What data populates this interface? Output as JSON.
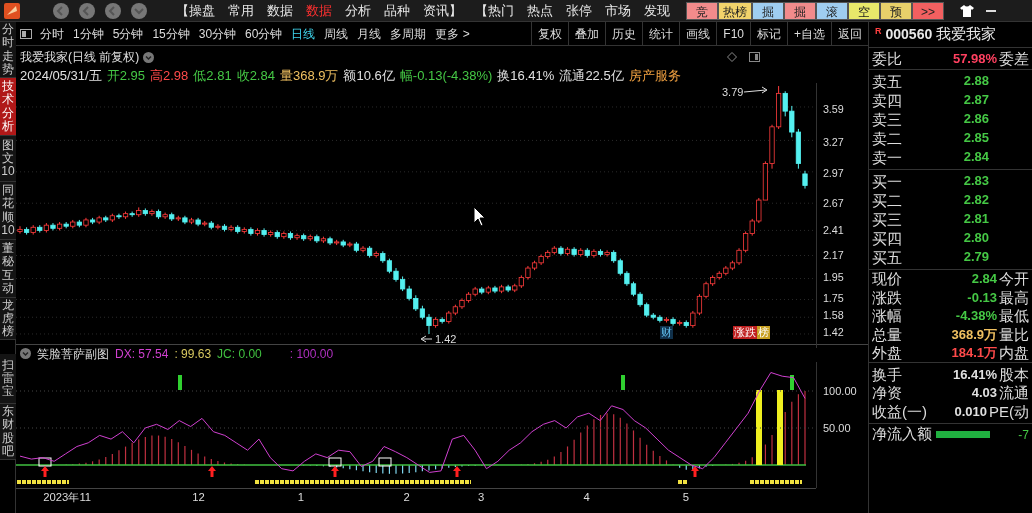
{
  "top_bar": {
    "menu": [
      {
        "label": "【操盘",
        "selected": false
      },
      {
        "label": "常用",
        "selected": false
      },
      {
        "label": "数据",
        "selected": false
      },
      {
        "label": "数据",
        "selected": true
      },
      {
        "label": "分析",
        "selected": false
      },
      {
        "label": "品种",
        "selected": false
      },
      {
        "label": "资讯】",
        "selected": false
      },
      {
        "label": "【热门",
        "selected": false
      },
      {
        "label": "热点",
        "selected": false
      },
      {
        "label": "张停",
        "selected": false
      },
      {
        "label": "市场",
        "selected": false
      },
      {
        "label": "发现",
        "selected": false
      }
    ],
    "quick_buttons": [
      {
        "label": "竞",
        "color": "#f28b8b"
      },
      {
        "label": "热榜",
        "color": "#f2d36b"
      },
      {
        "label": "掘",
        "color": "#9fcdf0"
      },
      {
        "label": "掘",
        "color": "#f28b8b"
      },
      {
        "label": "滚",
        "color": "#9fcdf0"
      },
      {
        "label": "空",
        "color": "#e8e86a"
      },
      {
        "label": "预",
        "color": "#e8d06a"
      },
      {
        "label": ">>",
        "color": "#f26060"
      }
    ]
  },
  "sidebar": {
    "tabs": [
      {
        "label": "分时走势",
        "selected": false
      },
      {
        "label": "技术分析",
        "selected": true
      },
      {
        "label": "图文10",
        "selected": false
      },
      {
        "label": "同花顺10",
        "selected": false
      },
      {
        "label": "董秘互动",
        "selected": false
      },
      {
        "label": "龙虎榜",
        "selected": false
      },
      {
        "label": "扫雷宝",
        "selected": false
      },
      {
        "label": "东财股吧",
        "selected": false
      }
    ]
  },
  "periods": [
    {
      "label": "分时",
      "selected": false
    },
    {
      "label": "1分钟",
      "selected": false
    },
    {
      "label": "5分钟",
      "selected": false
    },
    {
      "label": "15分钟",
      "selected": false
    },
    {
      "label": "30分钟",
      "selected": false
    },
    {
      "label": "60分钟",
      "selected": false
    },
    {
      "label": "日线",
      "selected": true
    },
    {
      "label": "周线",
      "selected": false
    },
    {
      "label": "月线",
      "selected": false
    },
    {
      "label": "多周期",
      "selected": false
    },
    {
      "label": "更多 >",
      "selected": false
    }
  ],
  "tools": [
    "复权",
    "叠加",
    "历史",
    "统计",
    "画线",
    "F10",
    "标记",
    "+自选",
    "返回"
  ],
  "chart": {
    "title": "我爱我家(日线 前复权)",
    "info": [
      {
        "text": "2024/05/31/五",
        "color": "#e0e0e0"
      },
      {
        "text": "开2.95",
        "color": "#45c845"
      },
      {
        "text": "高2.98",
        "color": "#ff4a4a"
      },
      {
        "text": "低2.81",
        "color": "#45c845"
      },
      {
        "text": "收2.84",
        "color": "#45c845"
      },
      {
        "text": "量368.9万",
        "color": "#f0c060"
      },
      {
        "text": "额10.6亿",
        "color": "#e0e0e0"
      },
      {
        "text": "幅-0.13(-4.38%)",
        "color": "#45c845"
      },
      {
        "text": "换16.41%",
        "color": "#e0e0e0"
      },
      {
        "text": "流通22.5亿",
        "color": "#e0e0e0"
      },
      {
        "text": "房产服务",
        "color": "#f0a040"
      }
    ],
    "high_label": "3.79",
    "low_label": "1.42",
    "markers": [
      {
        "label": "财",
        "kind": "plain"
      },
      {
        "label": "涨跌",
        "kind": "red"
      },
      {
        "label": "榜",
        "kind": "yellow"
      }
    ],
    "chart_data": {
      "type": "candlestick",
      "grid": true,
      "ylim": [
        1.286,
        3.819
      ],
      "yticks": [
        3.59,
        3.27,
        2.97,
        2.67,
        2.41,
        2.17,
        1.95,
        1.75,
        1.58,
        1.42
      ],
      "ohlc": [
        [
          2.4,
          2.45,
          2.38,
          2.42
        ],
        [
          2.42,
          2.44,
          2.37,
          2.39
        ],
        [
          2.39,
          2.46,
          2.37,
          2.44
        ],
        [
          2.44,
          2.46,
          2.39,
          2.41
        ],
        [
          2.41,
          2.48,
          2.39,
          2.46
        ],
        [
          2.46,
          2.48,
          2.41,
          2.43
        ],
        [
          2.43,
          2.49,
          2.41,
          2.47
        ],
        [
          2.47,
          2.49,
          2.43,
          2.45
        ],
        [
          2.45,
          2.51,
          2.43,
          2.49
        ],
        [
          2.49,
          2.51,
          2.44,
          2.46
        ],
        [
          2.46,
          2.53,
          2.44,
          2.51
        ],
        [
          2.51,
          2.53,
          2.47,
          2.49
        ],
        [
          2.49,
          2.55,
          2.47,
          2.53
        ],
        [
          2.53,
          2.55,
          2.49,
          2.51
        ],
        [
          2.51,
          2.57,
          2.49,
          2.55
        ],
        [
          2.55,
          2.57,
          2.52,
          2.54
        ],
        [
          2.54,
          2.59,
          2.52,
          2.57
        ],
        [
          2.57,
          2.59,
          2.54,
          2.56
        ],
        [
          2.56,
          2.63,
          2.54,
          2.6
        ],
        [
          2.6,
          2.62,
          2.55,
          2.57
        ],
        [
          2.57,
          2.61,
          2.55,
          2.59
        ],
        [
          2.59,
          2.61,
          2.52,
          2.54
        ],
        [
          2.54,
          2.58,
          2.52,
          2.56
        ],
        [
          2.56,
          2.58,
          2.5,
          2.52
        ],
        [
          2.52,
          2.55,
          2.5,
          2.53
        ],
        [
          2.53,
          2.55,
          2.47,
          2.49
        ],
        [
          2.49,
          2.53,
          2.47,
          2.51
        ],
        [
          2.51,
          2.53,
          2.45,
          2.47
        ],
        [
          2.47,
          2.5,
          2.45,
          2.48
        ],
        [
          2.48,
          2.5,
          2.42,
          2.44
        ],
        [
          2.44,
          2.47,
          2.42,
          2.45
        ],
        [
          2.45,
          2.47,
          2.4,
          2.42
        ],
        [
          2.42,
          2.46,
          2.4,
          2.44
        ],
        [
          2.44,
          2.46,
          2.38,
          2.4
        ],
        [
          2.4,
          2.44,
          2.38,
          2.42
        ],
        [
          2.42,
          2.44,
          2.36,
          2.38
        ],
        [
          2.38,
          2.43,
          2.36,
          2.41
        ],
        [
          2.41,
          2.43,
          2.35,
          2.37
        ],
        [
          2.37,
          2.41,
          2.35,
          2.39
        ],
        [
          2.39,
          2.41,
          2.33,
          2.35
        ],
        [
          2.35,
          2.4,
          2.33,
          2.38
        ],
        [
          2.38,
          2.4,
          2.32,
          2.34
        ],
        [
          2.34,
          2.38,
          2.32,
          2.36
        ],
        [
          2.36,
          2.38,
          2.31,
          2.33
        ],
        [
          2.33,
          2.37,
          2.31,
          2.35
        ],
        [
          2.35,
          2.37,
          2.29,
          2.31
        ],
        [
          2.31,
          2.35,
          2.29,
          2.33
        ],
        [
          2.33,
          2.35,
          2.27,
          2.29
        ],
        [
          2.29,
          2.32,
          2.27,
          2.3
        ],
        [
          2.3,
          2.32,
          2.25,
          2.27
        ],
        [
          2.27,
          2.3,
          2.25,
          2.28
        ],
        [
          2.28,
          2.3,
          2.2,
          2.22
        ],
        [
          2.22,
          2.26,
          2.2,
          2.24
        ],
        [
          2.24,
          2.26,
          2.15,
          2.17
        ],
        [
          2.17,
          2.21,
          2.15,
          2.19
        ],
        [
          2.19,
          2.21,
          2.1,
          2.12
        ],
        [
          2.12,
          2.14,
          2.0,
          2.02
        ],
        [
          2.02,
          2.05,
          1.92,
          1.94
        ],
        [
          1.94,
          1.97,
          1.83,
          1.85
        ],
        [
          1.85,
          1.88,
          1.74,
          1.76
        ],
        [
          1.76,
          1.79,
          1.64,
          1.66
        ],
        [
          1.66,
          1.69,
          1.56,
          1.58
        ],
        [
          1.58,
          1.61,
          1.42,
          1.5
        ],
        [
          1.5,
          1.58,
          1.48,
          1.56
        ],
        [
          1.56,
          1.58,
          1.52,
          1.54
        ],
        [
          1.54,
          1.64,
          1.52,
          1.62
        ],
        [
          1.62,
          1.7,
          1.6,
          1.68
        ],
        [
          1.68,
          1.76,
          1.66,
          1.74
        ],
        [
          1.74,
          1.82,
          1.72,
          1.8
        ],
        [
          1.8,
          1.87,
          1.78,
          1.85
        ],
        [
          1.85,
          1.87,
          1.8,
          1.82
        ],
        [
          1.82,
          1.88,
          1.8,
          1.86
        ],
        [
          1.86,
          1.88,
          1.81,
          1.83
        ],
        [
          1.83,
          1.89,
          1.81,
          1.87
        ],
        [
          1.87,
          1.89,
          1.82,
          1.84
        ],
        [
          1.84,
          1.9,
          1.82,
          1.88
        ],
        [
          1.88,
          1.98,
          1.86,
          1.96
        ],
        [
          1.96,
          2.07,
          1.94,
          2.05
        ],
        [
          2.05,
          2.12,
          2.03,
          2.1
        ],
        [
          2.1,
          2.18,
          2.08,
          2.16
        ],
        [
          2.16,
          2.22,
          2.14,
          2.2
        ],
        [
          2.2,
          2.26,
          2.18,
          2.24
        ],
        [
          2.24,
          2.26,
          2.17,
          2.19
        ],
        [
          2.19,
          2.25,
          2.17,
          2.23
        ],
        [
          2.23,
          2.25,
          2.16,
          2.18
        ],
        [
          2.18,
          2.24,
          2.16,
          2.22
        ],
        [
          2.22,
          2.24,
          2.15,
          2.17
        ],
        [
          2.17,
          2.23,
          2.15,
          2.21
        ],
        [
          2.21,
          2.23,
          2.16,
          2.18
        ],
        [
          2.18,
          2.22,
          2.16,
          2.2
        ],
        [
          2.2,
          2.22,
          2.1,
          2.12
        ],
        [
          2.12,
          2.14,
          1.98,
          2.0
        ],
        [
          2.0,
          2.02,
          1.88,
          1.9
        ],
        [
          1.9,
          1.92,
          1.78,
          1.8
        ],
        [
          1.8,
          1.82,
          1.68,
          1.7
        ],
        [
          1.7,
          1.72,
          1.58,
          1.6
        ],
        [
          1.6,
          1.62,
          1.56,
          1.58
        ],
        [
          1.58,
          1.6,
          1.53,
          1.55
        ],
        [
          1.55,
          1.58,
          1.53,
          1.56
        ],
        [
          1.56,
          1.58,
          1.5,
          1.52
        ],
        [
          1.52,
          1.55,
          1.5,
          1.53
        ],
        [
          1.53,
          1.55,
          1.48,
          1.5
        ],
        [
          1.5,
          1.64,
          1.48,
          1.62
        ],
        [
          1.62,
          1.8,
          1.6,
          1.78
        ],
        [
          1.78,
          1.92,
          1.76,
          1.9
        ],
        [
          1.9,
          1.98,
          1.88,
          1.96
        ],
        [
          1.96,
          2.02,
          1.94,
          2.0
        ],
        [
          2.0,
          2.07,
          1.98,
          2.05
        ],
        [
          2.05,
          2.12,
          2.03,
          2.1
        ],
        [
          2.1,
          2.24,
          2.08,
          2.22
        ],
        [
          2.22,
          2.4,
          2.2,
          2.38
        ],
        [
          2.38,
          2.52,
          2.36,
          2.5
        ],
        [
          2.5,
          2.72,
          2.48,
          2.7
        ],
        [
          2.7,
          3.07,
          2.7,
          3.05
        ],
        [
          3.05,
          3.42,
          3.0,
          3.4
        ],
        [
          3.4,
          3.79,
          3.38,
          3.72
        ],
        [
          3.72,
          3.74,
          3.5,
          3.55
        ],
        [
          3.55,
          3.6,
          3.3,
          3.35
        ],
        [
          3.35,
          3.38,
          3.0,
          3.05
        ],
        [
          2.95,
          2.98,
          2.81,
          2.84
        ]
      ]
    }
  },
  "indicator": {
    "title": "笑脸菩萨副图",
    "values": [
      {
        "text": ": 57.54",
        "color": "#d040d0"
      },
      {
        "text": ": 99.63",
        "color": "#d8c860"
      },
      {
        "text": "JC: 0.00",
        "color": "#40c040"
      },
      {
        "text": ": 100.00",
        "color": "#b030c0"
      }
    ],
    "dates": [
      "2023年11",
      "12",
      "1",
      "2",
      "3",
      "4",
      "5"
    ],
    "chart_data": {
      "type": "line",
      "grid": true,
      "ylim": [
        -31.08,
        139.19
      ],
      "yticks": [
        {
          "value": 100,
          "label": "100.00"
        },
        {
          "value": 50,
          "label": "50.00"
        }
      ],
      "series": [
        {
          "name": "DX",
          "color": "#d040d0",
          "values": [
            12,
            8,
            10,
            5,
            15,
            25,
            30,
            40,
            35,
            45,
            30,
            50,
            55,
            48,
            60,
            52,
            63,
            45,
            40,
            30,
            20,
            35,
            10,
            -5,
            -8,
            5,
            15,
            10,
            20,
            18,
            -2,
            5,
            25,
            18,
            10,
            0,
            -10,
            -8,
            35,
            40,
            20,
            -5,
            5,
            20,
            30,
            45,
            55,
            60,
            50,
            65,
            70,
            60,
            80,
            75,
            60,
            50,
            35,
            20,
            10,
            0,
            -5,
            10,
            30,
            50,
            70,
            100,
            125,
            120,
            118,
            90
          ]
        }
      ]
    }
  },
  "quote": {
    "code": "000560",
    "name": "我爱我家",
    "flag": "R",
    "ratio": {
      "label": "委比",
      "value": "57.98%",
      "label2": "委差"
    },
    "asks": [
      {
        "label": "卖五",
        "price": "2.88"
      },
      {
        "label": "卖四",
        "price": "2.87"
      },
      {
        "label": "卖三",
        "price": "2.86"
      },
      {
        "label": "卖二",
        "price": "2.85"
      },
      {
        "label": "卖一",
        "price": "2.84"
      }
    ],
    "bids": [
      {
        "label": "买一",
        "price": "2.83"
      },
      {
        "label": "买二",
        "price": "2.82"
      },
      {
        "label": "买三",
        "price": "2.81"
      },
      {
        "label": "买四",
        "price": "2.80"
      },
      {
        "label": "买五",
        "price": "2.79"
      }
    ],
    "stats": [
      {
        "label": "现价",
        "value": "2.84",
        "label2": "今开",
        "color": "#45c845"
      },
      {
        "label": "涨跌",
        "value": "-0.13",
        "label2": "最高",
        "color": "#45c845"
      },
      {
        "label": "涨幅",
        "value": "-4.38%",
        "label2": "最低",
        "color": "#45c845"
      },
      {
        "label": "总量",
        "value": "368.9万",
        "label2": "量比",
        "color": "#f0c060"
      },
      {
        "label": "外盘",
        "value": "184.1万",
        "label2": "内盘",
        "color": "#ff4a4a"
      }
    ],
    "stats2": [
      {
        "label": "换手",
        "value": "16.41%",
        "label2": "股本"
      },
      {
        "label": "净资",
        "value": "4.03",
        "label2": "流通"
      },
      {
        "label": "收益(一)",
        "value": "0.010",
        "label2": "PE(动"
      }
    ],
    "net_inflow": {
      "label": "净流入额",
      "value": "-7"
    }
  }
}
